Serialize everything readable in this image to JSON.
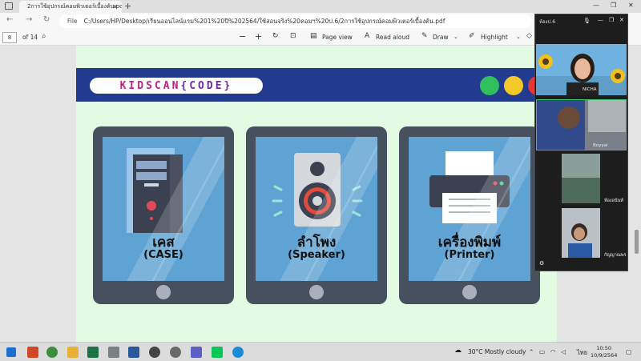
{
  "browser": {
    "tab_title": "2การใช้อุปกรณ์คอมพิวเตอร์เบื้องต้น.pdf",
    "url_prefix": "File",
    "url": "C:/Users/HP/Desktop/เรียนออนไลน์แรม%201%20ปี%202564/ใช้สอนจริง%20คอมฯ%20ป.6/2การใช้อุปกรณ์คอมพิวเตอร์เบื้องต้น.pdf"
  },
  "pdf_toolbar": {
    "page_current": "8",
    "page_total": "of 14",
    "page_view": "Page view",
    "read_aloud": "Read aloud",
    "draw": "Draw",
    "highlight": "Highlight"
  },
  "slide": {
    "logo_part1": "KIDSCAN",
    "logo_part2": "{CODE}",
    "dots": [
      "#2fbf5b",
      "#f5c82a",
      "#e53935"
    ],
    "cards": [
      {
        "thai": "เคส",
        "eng": "(CASE)"
      },
      {
        "thai": "ลำโพง",
        "eng": "(Speaker)"
      },
      {
        "thai": "เครื่องพิมพ์",
        "eng": "(Printer)"
      }
    ]
  },
  "meeting": {
    "title": "ห้องป.6",
    "participants": [
      "NICHA",
      "Boyyai",
      "ห้องอนันท์",
      "กัญญาณพร"
    ]
  },
  "taskbar": {
    "weather": "30°C  Mostly cloudy",
    "lang": "ไทย",
    "time": "10:50",
    "date": "10/9/2564"
  }
}
